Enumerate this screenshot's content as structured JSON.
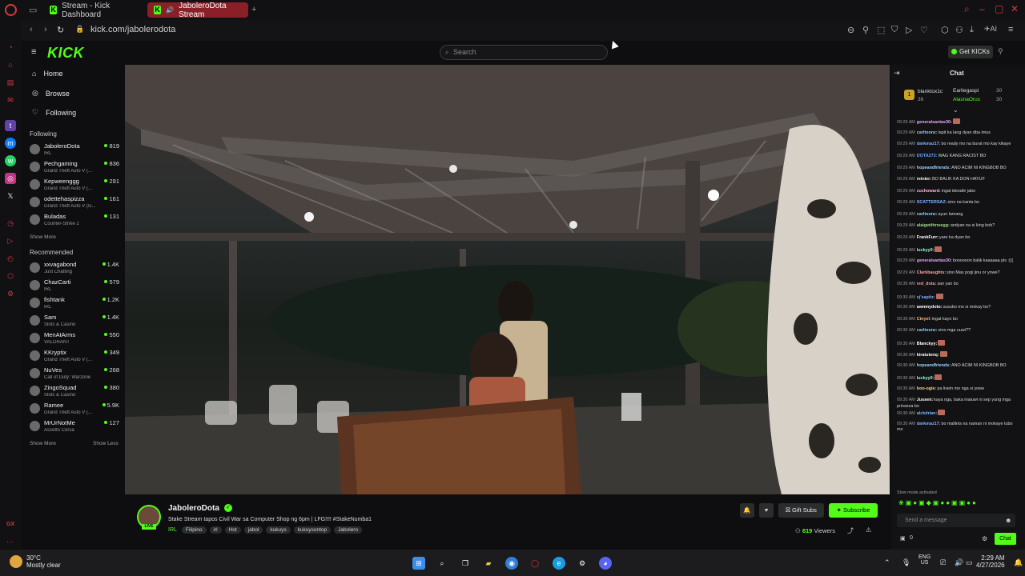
{
  "browser": {
    "tabs": [
      {
        "label": "Stream - Kick Dashboard",
        "active": false
      },
      {
        "label": "JaboleroDota Stream",
        "active": true
      }
    ],
    "url": "kick.com/jabolerodota"
  },
  "header": {
    "logo": "KICK",
    "search_placeholder": "Search",
    "get_kicks": "Get KICKs"
  },
  "nav": {
    "items": [
      {
        "label": "Home",
        "icon": "home-icon"
      },
      {
        "label": "Browse",
        "icon": "compass-icon"
      },
      {
        "label": "Following",
        "icon": "heart-icon"
      }
    ],
    "following_title": "Following",
    "following": [
      {
        "name": "JaboleroDota",
        "category": "IRL",
        "viewers": "819"
      },
      {
        "name": "Pechgaming",
        "category": "Grand Theft Auto V (...",
        "viewers": "836"
      },
      {
        "name": "Kepweenggg",
        "category": "Grand Theft Auto V (...",
        "viewers": "291"
      },
      {
        "name": "odettehaspizza",
        "category": "Grand Theft Auto V (G...",
        "viewers": "161"
      },
      {
        "name": "Buladas",
        "category": "Counter-Strike 2",
        "viewers": "131"
      }
    ],
    "show_more_following": "Show More",
    "recommended_title": "Recommended",
    "recommended": [
      {
        "name": "xxvagabond",
        "category": "Just Chatting",
        "viewers": "1.4K"
      },
      {
        "name": "ChazCarti",
        "category": "IRL",
        "viewers": "579"
      },
      {
        "name": "fishtank",
        "category": "IRL",
        "viewers": "1.2K"
      },
      {
        "name": "Sam",
        "category": "Slots & Casino",
        "viewers": "1.4K"
      },
      {
        "name": "MenAtArms",
        "category": "VALORANT",
        "viewers": "550"
      },
      {
        "name": "KKryptix",
        "category": "Grand Theft Auto V (...",
        "viewers": "349"
      },
      {
        "name": "NuVes",
        "category": "Call of Duty: Warzone",
        "viewers": "268"
      },
      {
        "name": "ZingoSquad",
        "category": "Slots & Casino",
        "viewers": "380"
      },
      {
        "name": "Ramee",
        "category": "Grand Theft Auto V (...",
        "viewers": "5.9K"
      },
      {
        "name": "MrUrNotMe",
        "category": "Assetto Corsa",
        "viewers": "127"
      }
    ],
    "show_more": "Show More",
    "show_less": "Show Less"
  },
  "stream": {
    "streamer": "JaboleroDota",
    "live": "LIVE",
    "title": "Stake Stream tapos Civil War sa Computer Shop ng 6pm | LFG!!!! #StakeNumba1",
    "category": "IRL",
    "tags": [
      "Filipino",
      "irl",
      "Hot",
      "jabol",
      "kukuys",
      "kukuysontop",
      "Jabolero"
    ],
    "gift_subs": "Gift Subs",
    "subscribe": "Subscribe",
    "viewers": "819",
    "viewers_label": "Viewers"
  },
  "chat": {
    "title": "Chat",
    "pinned": [
      {
        "name": "blanktox1c",
        "value": "36"
      },
      {
        "name": "Earliegaspi",
        "value": "30"
      },
      {
        "name": "AlasnaOrus",
        "value": "30"
      }
    ],
    "messages": [
      {
        "time": "09:29 AM",
        "user": "generalsantas30:",
        "text": "",
        "color": "#e0a8ff"
      },
      {
        "time": "09:29 AM",
        "user": "carltoonz:",
        "text": "lapit ka lang dyan dba imus",
        "color": "#8ad0ff"
      },
      {
        "time": "09:29 AM",
        "user": "darkmaz17:",
        "text": "bo ready mo na burat mo kay kikaye",
        "color": "#7fb3ff"
      },
      {
        "time": "09:29 AM",
        "user": "DOTA273:",
        "text": "WAG KANG RACIST BO",
        "color": "#66a3ff"
      },
      {
        "time": "09:29 AM",
        "user": "hopeandfriends:",
        "text": "ANO ACIM NI KINGBOB BO",
        "color": "#9ad5ff"
      },
      {
        "time": "09:29 AM",
        "user": "reinier:",
        "text": "BO BALIK KA DON HAYUF",
        "color": "#ffffff"
      },
      {
        "time": "09:29 AM",
        "user": "zuchoward:",
        "text": "ingat idesafe jabo",
        "color": "#ffb3e6"
      },
      {
        "time": "09:29 AM",
        "user": "SCATTERSAZ:",
        "text": "sino na kanta bo",
        "color": "#7fb3ff"
      },
      {
        "time": "09:29 AM",
        "user": "carltoonz:",
        "text": "ayun lamang",
        "color": "#8ad0ff"
      },
      {
        "time": "09:29 AM",
        "user": "alaigwithnoegg:",
        "text": "andyan na si king bob?",
        "color": "#9fd88a"
      },
      {
        "time": "09:29 AM",
        "user": "FrankFurr:",
        "text": "yare ka dyan bo",
        "color": "#ffffff"
      },
      {
        "time": "09:29 AM",
        "user": "luckyy0:",
        "text": "",
        "color": "#8affd0"
      },
      {
        "time": "09:29 AM",
        "user": "generalsantas30:",
        "text": "boooooon balik kaaaaaa pls :(((",
        "color": "#e0a8ff"
      },
      {
        "time": "09:29 AM",
        "user": "Clarkbaughts:",
        "text": "sino Mas pogi jinu or yowe?",
        "color": "#ffa3a3"
      },
      {
        "time": "09:30 AM",
        "user": "red_dota:",
        "text": "san yan bo",
        "color": "#ff9a9a"
      },
      {
        "time": "09:30 AM",
        "user": "vj'sapitz:",
        "text": "",
        "color": "#7fb3ff"
      },
      {
        "time": "09:30 AM",
        "user": "awnmydoto:",
        "text": "susubo mo si mokay bo?",
        "color": "#ffffff"
      },
      {
        "time": "09:30 AM",
        "user": "Cinyel:",
        "text": "ingat kayo bo",
        "color": "#ffb380"
      },
      {
        "time": "09:30 AM",
        "user": "carltoonz:",
        "text": "sino mga uuwi??",
        "color": "#8ad0ff"
      },
      {
        "time": "09:30 AM",
        "user": "Blanckyy:",
        "text": "",
        "color": "#ffffff"
      },
      {
        "time": "09:30 AM",
        "user": "kiratutenq:",
        "text": "",
        "color": "#ffffff"
      },
      {
        "time": "09:30 AM",
        "user": "hopeandfriends:",
        "text": "ANO ACIM NI KINGBOB BO",
        "color": "#9ad5ff"
      },
      {
        "time": "09:30 AM",
        "user": "luckyy0:",
        "text": "",
        "color": "#8affd0"
      },
      {
        "time": "09:30 AM",
        "user": "boo-ogie:",
        "text": "pa livein mo nga si yowe",
        "color": "#ffd27f"
      },
      {
        "time": "09:30 AM",
        "user": "Jussen:",
        "text": "kaya nga, baka maiuwi ni sep yung mga prinsesa bo",
        "color": "#ffffff"
      },
      {
        "time": "09:30 AM",
        "user": "alckdrian:",
        "text": "",
        "color": "#7fb3ff"
      },
      {
        "time": "09:30 AM",
        "user": "darkmaz17:",
        "text": "bo mallinis na naman ni mokaye tubo mo",
        "color": "#7fb3ff"
      }
    ],
    "slow_mode": "Slow mode activated",
    "input_placeholder": "Send a message",
    "points": "0",
    "send": "Chat"
  },
  "taskbar": {
    "temperature": "30°C",
    "weather": "Mostly clear",
    "lang": "ENG",
    "region": "US",
    "time": "2:29 AM",
    "date": "4/27/2026",
    "gx": "GX"
  }
}
